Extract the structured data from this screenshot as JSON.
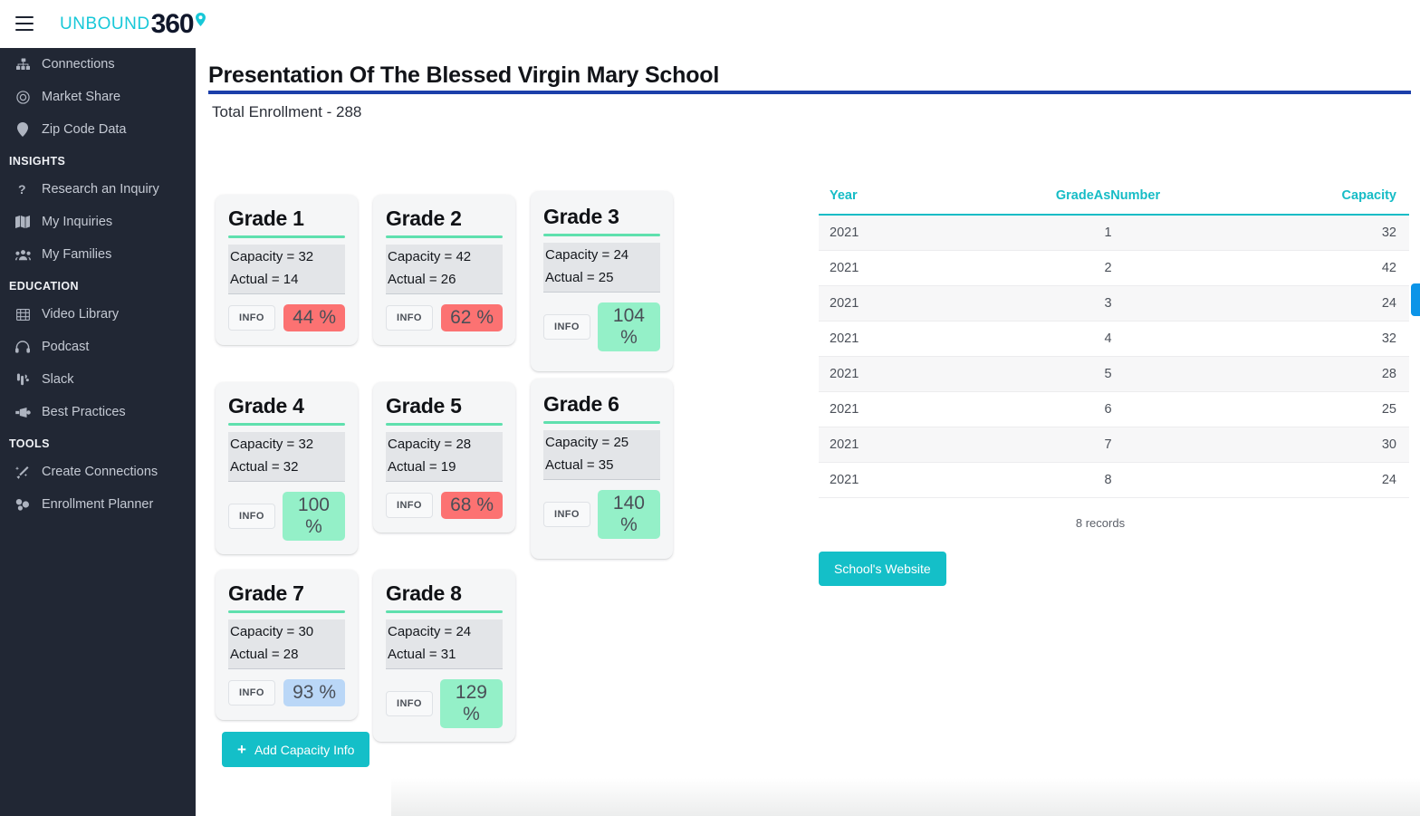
{
  "topbar": {
    "menu_icon": "hamburger-icon",
    "logo": {
      "word": "UNBOUND",
      "number": "360",
      "pin_icon": "location-pin-icon"
    }
  },
  "sidebar": {
    "items": [
      {
        "label": "Connections",
        "icon": "sitemap-icon",
        "type": "item"
      },
      {
        "label": "Market Share",
        "icon": "target-icon",
        "type": "item"
      },
      {
        "label": "Zip Code Data",
        "icon": "map-pin-icon",
        "type": "item"
      },
      {
        "label": "INSIGHTS",
        "type": "section"
      },
      {
        "label": "Research an Inquiry",
        "icon": "question-icon",
        "type": "item"
      },
      {
        "label": "My Inquiries",
        "icon": "book-icon",
        "type": "item"
      },
      {
        "label": "My Families",
        "icon": "users-icon",
        "type": "item"
      },
      {
        "label": "EDUCATION",
        "type": "section"
      },
      {
        "label": "Video Library",
        "icon": "film-icon",
        "type": "item"
      },
      {
        "label": "Podcast",
        "icon": "headphones-icon",
        "type": "item"
      },
      {
        "label": "Slack",
        "icon": "slack-icon",
        "type": "item"
      },
      {
        "label": "Best Practices",
        "icon": "megaphone-icon",
        "type": "item"
      },
      {
        "label": "TOOLS",
        "type": "section"
      },
      {
        "label": "Create Connections",
        "icon": "magic-wand-icon",
        "type": "item"
      },
      {
        "label": "Enrollment Planner",
        "icon": "planner-icon",
        "type": "item"
      }
    ]
  },
  "header": {
    "title": "Presentation Of The Blessed Virgin Mary School",
    "subtitle": "Total Enrollment - 288",
    "rule_color": "#1c3faa"
  },
  "cards": {
    "capacity_prefix": "Capacity = ",
    "actual_prefix": "Actual = ",
    "info_label": "INFO",
    "accent_color": "#5fe0ae",
    "items": [
      {
        "title": "Grade 1",
        "capacity": "Capacity = 32",
        "actual": "Actual = 14",
        "info": "INFO",
        "pct": "44 %",
        "tone": "red"
      },
      {
        "title": "Grade 2",
        "capacity": "Capacity = 42",
        "actual": "Actual = 26",
        "info": "INFO",
        "pct": "62 %",
        "tone": "red"
      },
      {
        "title": "Grade 3",
        "capacity": "Capacity = 24",
        "actual": "Actual = 25",
        "info": "INFO",
        "pct": "104 %",
        "tone": "green"
      },
      {
        "title": "Grade 4",
        "capacity": "Capacity = 32",
        "actual": "Actual = 32",
        "info": "INFO",
        "pct": "100 %",
        "tone": "green"
      },
      {
        "title": "Grade 5",
        "capacity": "Capacity = 28",
        "actual": "Actual = 19",
        "info": "INFO",
        "pct": "68 %",
        "tone": "red"
      },
      {
        "title": "Grade 6",
        "capacity": "Capacity = 25",
        "actual": "Actual = 35",
        "info": "INFO",
        "pct": "140 %",
        "tone": "green"
      },
      {
        "title": "Grade 7",
        "capacity": "Capacity = 30",
        "actual": "Actual = 28",
        "info": "INFO",
        "pct": "93 %",
        "tone": "blue"
      },
      {
        "title": "Grade 8",
        "capacity": "Capacity = 24",
        "actual": "Actual = 31",
        "info": "INFO",
        "pct": "129 %",
        "tone": "green"
      }
    ],
    "add_button": {
      "label": "Add Capacity Info",
      "icon": "plus-icon"
    }
  },
  "table": {
    "columns": [
      "Year",
      "GradeAsNumber",
      "Capacity"
    ],
    "rows": [
      [
        "2021",
        "1",
        "32"
      ],
      [
        "2021",
        "2",
        "42"
      ],
      [
        "2021",
        "3",
        "24"
      ],
      [
        "2021",
        "4",
        "32"
      ],
      [
        "2021",
        "5",
        "28"
      ],
      [
        "2021",
        "6",
        "25"
      ],
      [
        "2021",
        "7",
        "30"
      ],
      [
        "2021",
        "8",
        "24"
      ]
    ],
    "record_count": "8 records",
    "header_color": "#16bcc6"
  },
  "website_button": {
    "label": "School's Website"
  },
  "edge_tab": {
    "color": "#0c94e8"
  }
}
